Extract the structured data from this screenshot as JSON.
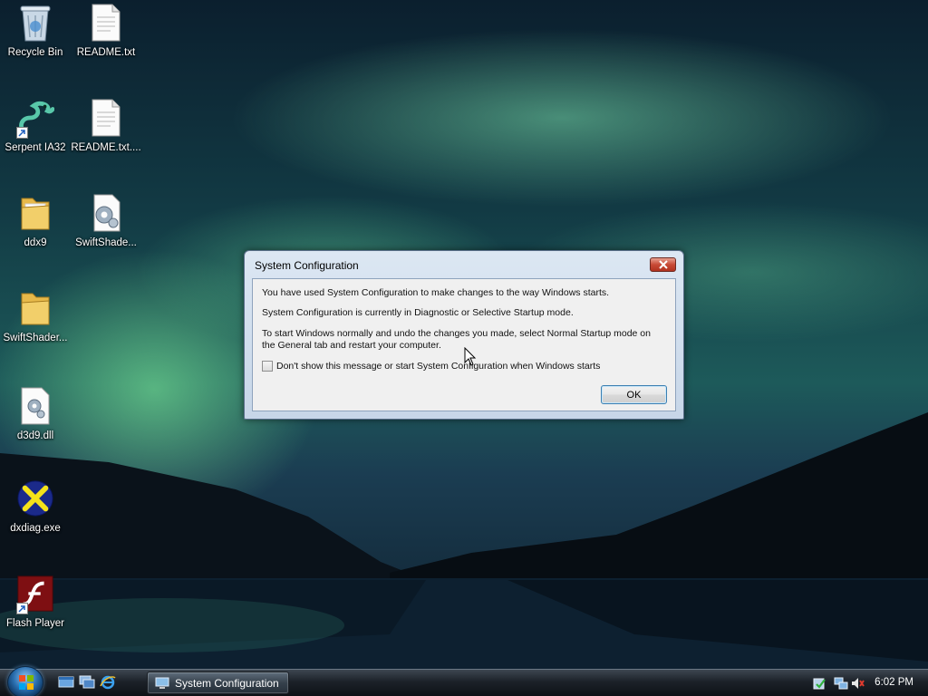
{
  "desktop": {
    "icons": [
      {
        "label": "Recycle Bin",
        "icon": "recycle-bin-icon"
      },
      {
        "label": "README.txt",
        "icon": "text-file-icon"
      },
      {
        "label": "Serpent IA32",
        "icon": "serpent-icon"
      },
      {
        "label": "README.txt....",
        "icon": "text-file-icon"
      },
      {
        "label": "ddx9",
        "icon": "folder-icon"
      },
      {
        "label": "SwiftShade...",
        "icon": "settings-file-icon"
      },
      {
        "label": "SwiftShader...",
        "icon": "folder-icon"
      },
      {
        "label": "d3d9.dll",
        "icon": "dll-file-icon"
      },
      {
        "label": "dxdiag.exe",
        "icon": "dxdiag-icon"
      },
      {
        "label": "Flash Player",
        "icon": "flash-player-icon"
      }
    ]
  },
  "dialog": {
    "title": "System Configuration",
    "message1": "You have used System Configuration to make changes to the way Windows starts.",
    "message2": "System Configuration is currently in Diagnostic or Selective Startup mode.",
    "message3_line1": "To start Windows normally and undo the changes you made, select Normal Startup mode on",
    "message3_line2": "the General tab and restart your computer.",
    "checkbox_label": "Don't show this message or start System Configuration when Windows starts",
    "checkbox_checked": false,
    "ok_label": "OK"
  },
  "taskbar": {
    "task_label": "System Configuration",
    "clock": "6:02 PM"
  },
  "colors": {
    "titlebar": "#dce7f3",
    "close_button": "#c84a36",
    "taskbar": "#1c2229"
  }
}
